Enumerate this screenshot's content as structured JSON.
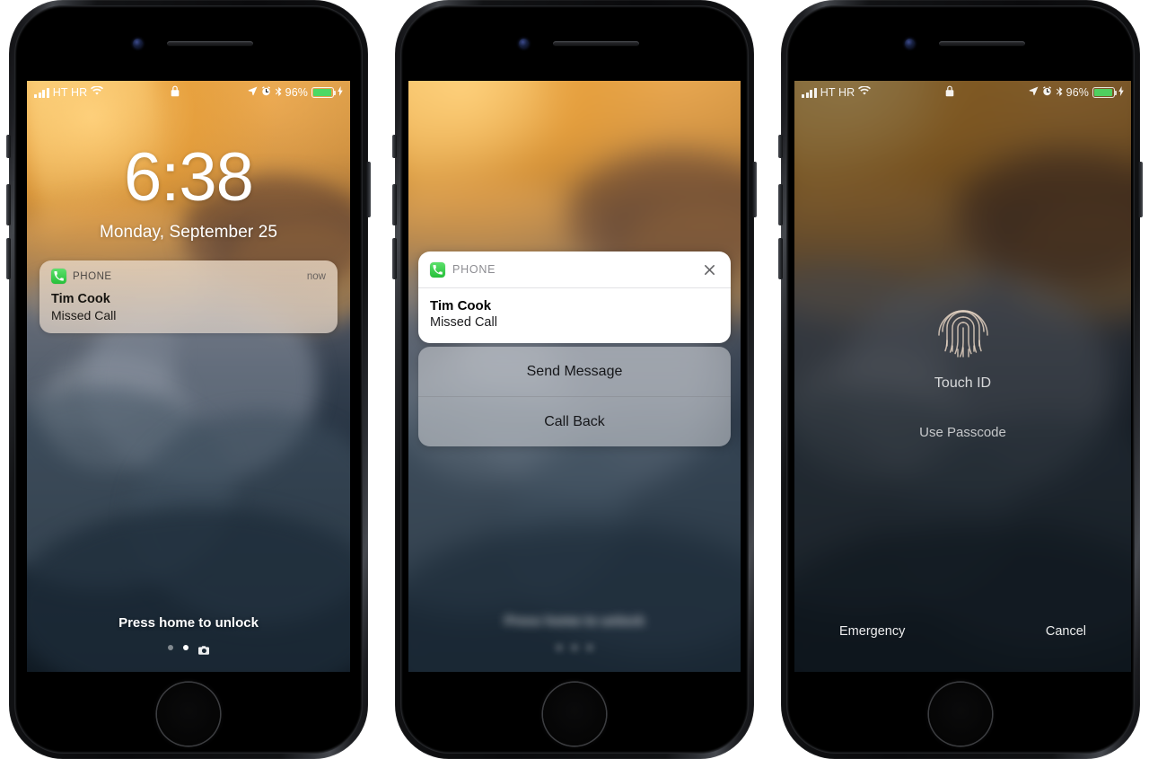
{
  "status_bar": {
    "carrier": "HT HR",
    "battery_percent": "96%",
    "icons": [
      "signal-bars-icon",
      "wifi-icon",
      "lock-icon",
      "location-arrow-icon",
      "alarm-clock-icon",
      "bluetooth-icon",
      "battery-icon",
      "charging-bolt-icon"
    ],
    "battery_color": "#4cd964"
  },
  "phone1": {
    "time": "6:38",
    "date": "Monday, September 25",
    "notification": {
      "app_name": "PHONE",
      "time_label": "now",
      "title": "Tim Cook",
      "subtitle": "Missed Call",
      "app_icon": "phone-handset-icon",
      "app_icon_color": "#3ccc4e"
    },
    "unlock_hint": "Press home to unlock",
    "page_dots": 2,
    "active_dot_index": 1,
    "camera_shortcut_icon": "camera-icon"
  },
  "phone2": {
    "notification_card": {
      "app_name": "PHONE",
      "title": "Tim Cook",
      "subtitle": "Missed Call",
      "close_icon": "close-x-icon",
      "app_icon": "phone-handset-icon"
    },
    "actions": [
      {
        "label": "Send Message"
      },
      {
        "label": "Call Back"
      }
    ]
  },
  "phone3": {
    "touch_id_icon": "fingerprint-icon",
    "touch_id_label": "Touch ID",
    "use_passcode": "Use Passcode",
    "emergency": "Emergency",
    "cancel": "Cancel"
  }
}
